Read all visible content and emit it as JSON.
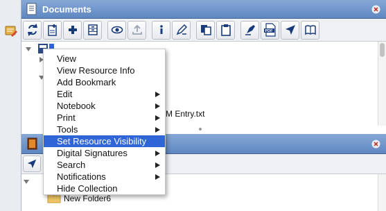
{
  "documents_panel": {
    "title": "Documents",
    "toolbar": [
      {
        "name": "sync-button",
        "icon": "sync-icon"
      },
      {
        "name": "new-document-button",
        "icon": "new-document-icon"
      },
      {
        "name": "add-button",
        "icon": "plus-icon"
      },
      {
        "name": "cabinet-button",
        "icon": "cabinet-icon"
      },
      {
        "name": "view-button",
        "icon": "eye-icon"
      },
      {
        "name": "upload-button",
        "icon": "upload-icon"
      },
      {
        "name": "info-button",
        "icon": "info-icon"
      },
      {
        "name": "rename-button",
        "icon": "pen-icon"
      },
      {
        "name": "copy-button",
        "icon": "copy-icon"
      },
      {
        "name": "clipboard-button",
        "icon": "clipboard-icon"
      },
      {
        "name": "sign-button",
        "icon": "fountain-pen-icon"
      },
      {
        "name": "pdf-button",
        "icon": "pdf-icon"
      },
      {
        "name": "navigate-button",
        "icon": "navigate-arrow-icon"
      },
      {
        "name": "book-button",
        "icon": "book-icon"
      }
    ],
    "tree": {
      "partial_file_label": "M Entry.txt"
    }
  },
  "context_menu": {
    "items": [
      {
        "label": "View",
        "submenu": false,
        "active": false
      },
      {
        "label": "View Resource Info",
        "submenu": false,
        "active": false
      },
      {
        "label": "Add Bookmark",
        "submenu": false,
        "active": false
      },
      {
        "label": "Edit",
        "submenu": true,
        "active": false
      },
      {
        "label": "Notebook",
        "submenu": true,
        "active": false
      },
      {
        "label": "Print",
        "submenu": true,
        "active": false
      },
      {
        "label": "Tools",
        "submenu": true,
        "active": false
      },
      {
        "label": "Set Resource Visibility",
        "submenu": false,
        "active": true
      },
      {
        "label": "Digital Signatures",
        "submenu": true,
        "active": false
      },
      {
        "label": "Search",
        "submenu": true,
        "active": false
      },
      {
        "label": "Notifications",
        "submenu": true,
        "active": false
      },
      {
        "label": "Hide Collection",
        "submenu": false,
        "active": false
      }
    ]
  },
  "second_panel": {
    "folder_label": "New Folder6"
  },
  "colors": {
    "header": "#6b8fc7",
    "menu_highlight": "#2f65d6"
  }
}
